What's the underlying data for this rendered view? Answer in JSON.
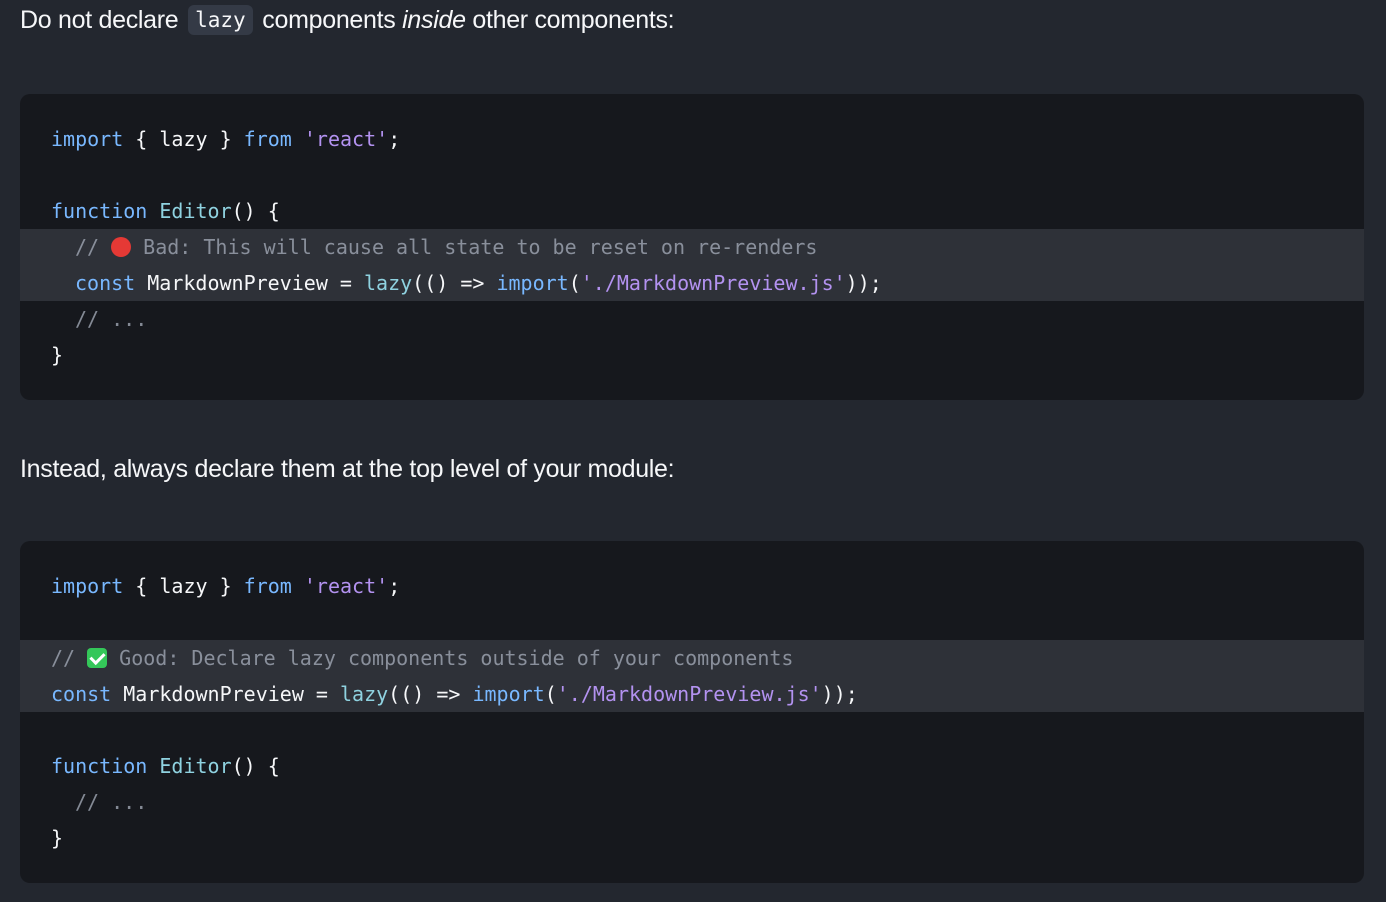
{
  "section1": {
    "heading_pre": "Do not declare",
    "heading_code": "lazy",
    "heading_mid": "components",
    "heading_em": "inside",
    "heading_post": "other components:"
  },
  "code1": {
    "l1": {
      "kw": "import",
      "p1": " { ",
      "id": "lazy",
      "p2": " } ",
      "kw2": "from",
      "sp": " ",
      "str": "'react'",
      "end": ";"
    },
    "l2": {
      "kw": "function",
      "sp": " ",
      "fn": "Editor",
      "end": "() {"
    },
    "l3": {
      "c1": "// ",
      "c2": " Bad: This will cause all state to be reset on re-renders"
    },
    "l4": {
      "kw": "const",
      "id": " MarkdownPreview = ",
      "fn": "lazy",
      "p1": "(() => ",
      "kw2": "import",
      "p2": "(",
      "str": "'./MarkdownPreview.js'",
      "end": "));"
    },
    "l5": {
      "c": "// ..."
    },
    "l6": {
      "end": "}"
    }
  },
  "section2": {
    "heading": "Instead, always declare them at the top level of your module:"
  },
  "code2": {
    "l1": {
      "kw": "import",
      "p1": " { ",
      "id": "lazy",
      "p2": " } ",
      "kw2": "from",
      "sp": " ",
      "str": "'react'",
      "end": ";"
    },
    "l2": {
      "c1": "// ",
      "c2": " Good: Declare lazy components outside of your components"
    },
    "l3": {
      "kw": "const",
      "id": " MarkdownPreview = ",
      "fn": "lazy",
      "p1": "(() => ",
      "kw2": "import",
      "p2": "(",
      "str": "'./MarkdownPreview.js'",
      "end": "));"
    },
    "l4": {
      "kw": "function",
      "sp": " ",
      "fn": "Editor",
      "end": "() {"
    },
    "l5": {
      "c": "// ..."
    },
    "l6": {
      "end": "}"
    }
  },
  "icons": {
    "bad": "red-circle-icon",
    "good": "green-check-icon"
  },
  "colors": {
    "background": "#23272f",
    "code_background": "#16181d",
    "highlight": "#2e3138",
    "keyword": "#99a1b3",
    "keyword_import": "#79b8ff",
    "function": "#8fd2e0",
    "string": "#b392f0",
    "bad_dot": "#e53935",
    "good_check": "#34c759"
  }
}
